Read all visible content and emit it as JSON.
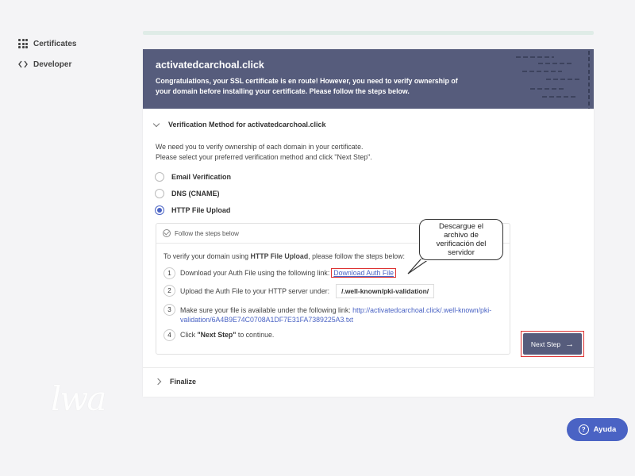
{
  "sidebar": {
    "items": [
      {
        "label": "Certificates",
        "icon": "grid-icon"
      },
      {
        "label": "Developer",
        "icon": "code-icon"
      }
    ]
  },
  "banner": {
    "domain": "activatedcarchoal.click",
    "message": "Congratulations, your SSL certificate is en route! However, you need to verify ownership of your domain before installing your certificate. Please follow the steps below."
  },
  "verification": {
    "heading": "Verification Method for activatedcarchoal.click",
    "intro_line1": "We need you to verify ownership of each domain in your certificate.",
    "intro_line2": "Please select your preferred verification method and click \"Next Step\".",
    "options": [
      {
        "label": "Email Verification",
        "selected": false
      },
      {
        "label": "DNS (CNAME)",
        "selected": false
      },
      {
        "label": "HTTP File Upload",
        "selected": true
      }
    ]
  },
  "steps": {
    "header": "Follow the steps below",
    "intro_prefix": "To verify your domain using ",
    "intro_method": "HTTP File Upload",
    "intro_suffix": ", please follow the steps below:",
    "step1_num": "1",
    "step1_text": "Download your Auth File using the following link:",
    "step1_link": "Download Auth File",
    "step2_num": "2",
    "step2_text": "Upload the Auth File to your HTTP server under:",
    "step2_path": "/.well-known/pki-validation/",
    "step3_num": "3",
    "step3_text": "Make sure your file is available under the following link:",
    "step3_url": "http://activatedcarchoal.click/.well-known/pki-validation/6A4B9E74C0708A1DF7E31FA7389225A3.txt",
    "step4_num": "4",
    "step4_prefix": "Click ",
    "step4_bold": "\"Next Step\"",
    "step4_suffix": " to continue."
  },
  "callout": {
    "line1": "Descargue el",
    "line2": "archivo de",
    "line3": "verificación del",
    "line4": "servidor"
  },
  "next_button": {
    "label": "Next Step",
    "arrow": "→"
  },
  "finalize": {
    "label": "Finalize"
  },
  "logo": {
    "text": "lwa"
  },
  "help": {
    "label": "Ayuda",
    "icon_glyph": "?"
  },
  "colors": {
    "banner": "#565c7c",
    "accent": "#4a63c4",
    "highlight": "#dd3333"
  }
}
